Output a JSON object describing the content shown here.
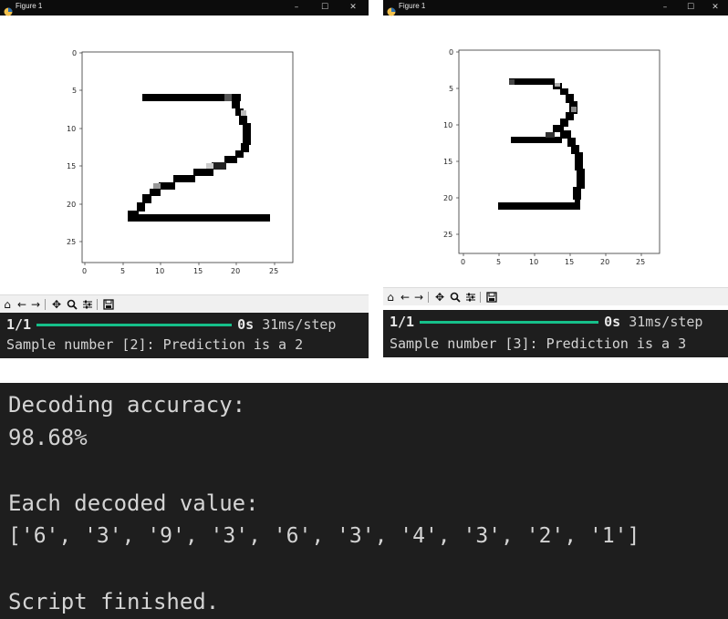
{
  "windows": [
    {
      "title": "Figure 1",
      "controls": [
        "–",
        "☐",
        "✕"
      ],
      "yticks": [
        "0",
        "5",
        "10",
        "15",
        "20",
        "25"
      ],
      "xticks": [
        "0",
        "5",
        "10",
        "15",
        "20",
        "25"
      ],
      "terminal": {
        "step": "1/1",
        "time": "0s",
        "rate": "31ms/step",
        "message": "Sample number [2]: Prediction is a 2"
      }
    },
    {
      "title": "Figure 1",
      "controls": [
        "–",
        "☐",
        "✕"
      ],
      "yticks": [
        "0",
        "5",
        "10",
        "15",
        "20",
        "25"
      ],
      "xticks": [
        "0",
        "5",
        "10",
        "15",
        "20",
        "25"
      ],
      "terminal": {
        "step": "1/1",
        "time": "0s",
        "rate": "31ms/step",
        "message": "Sample number [3]: Prediction is a 3"
      }
    }
  ],
  "toolbar_icons": [
    "home-icon",
    "back-arrow-icon",
    "forward-arrow-icon",
    "pan-icon",
    "zoom-icon",
    "configure-subplots-icon",
    "save-icon"
  ],
  "console": {
    "accuracy_label": "Decoding accuracy:",
    "accuracy_value": "98.68%",
    "decoded_label": "Each decoded value:",
    "decoded_values": "['6', '3', '9', '3', '6', '3', '4', '3', '2', '1']",
    "finished": "Script finished."
  },
  "colors": {
    "terminal_bg": "#1e1e1e",
    "progress": "#16c08a",
    "titlebar": "#0c0c0c"
  }
}
